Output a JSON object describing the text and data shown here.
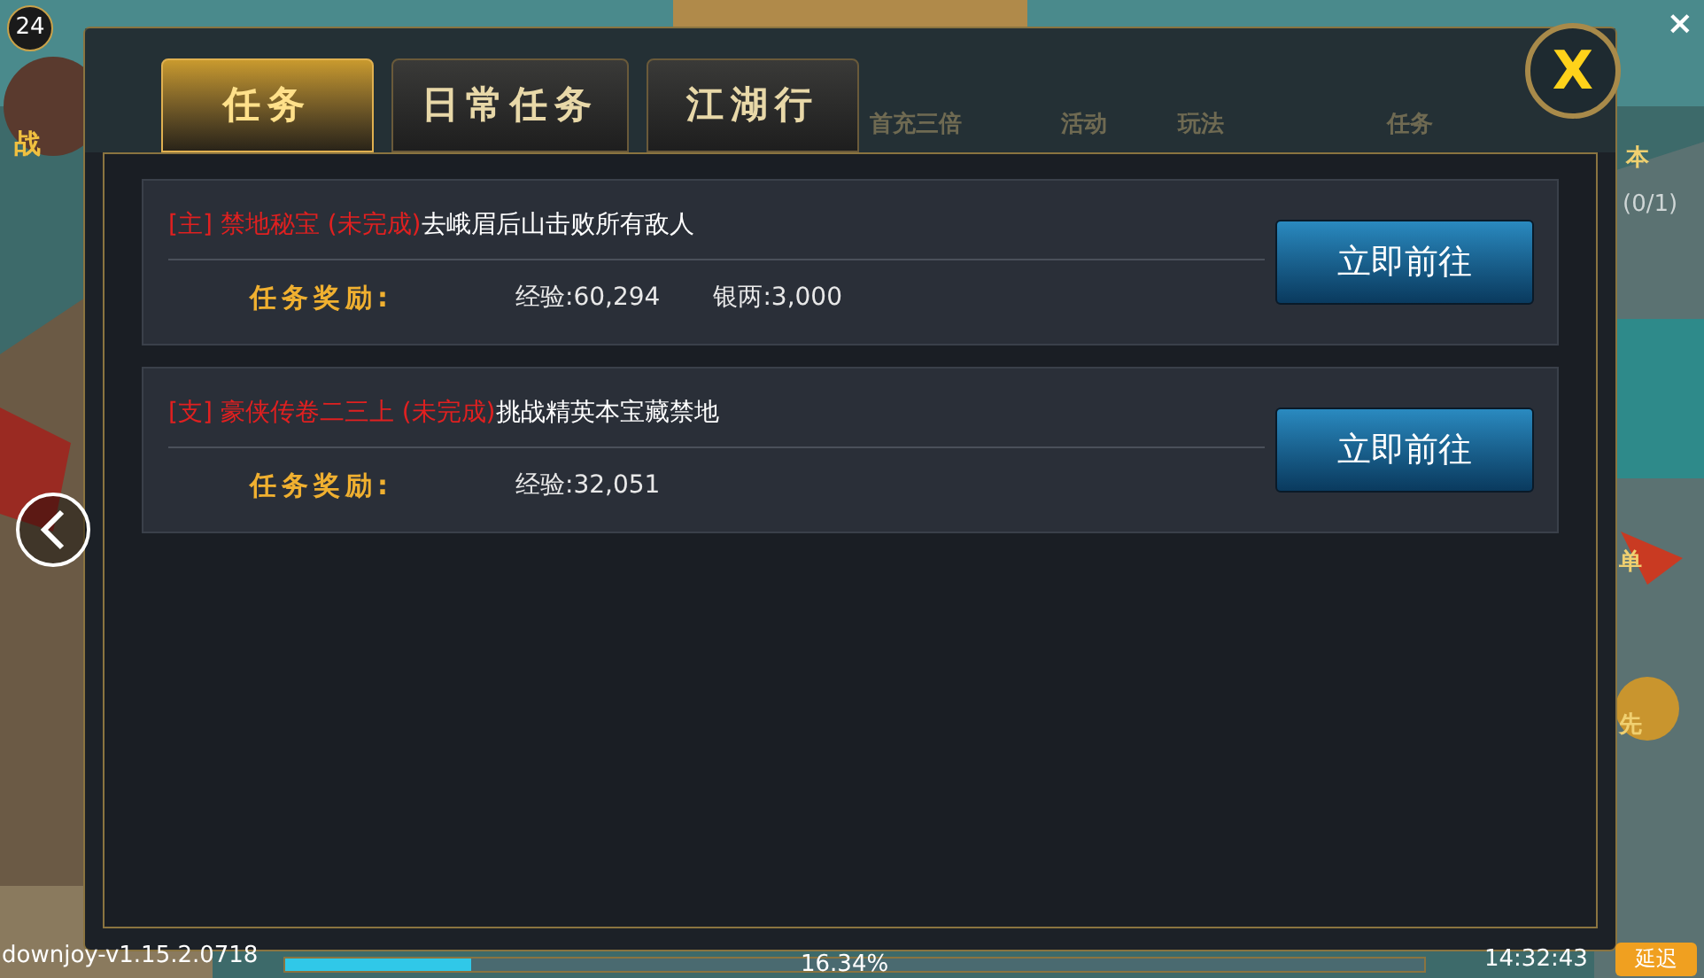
{
  "hud": {
    "level": "24",
    "power_label": "战",
    "corner_close": "×",
    "menu_labels": [
      "首充三倍",
      "活动",
      "玩法",
      "任务"
    ],
    "side_labels": [
      "本",
      "(0/1)",
      "单",
      "先"
    ]
  },
  "dialog": {
    "tabs": [
      {
        "label": "任务",
        "selected": true
      },
      {
        "label": "日常任务",
        "selected": false
      },
      {
        "label": "江湖行",
        "selected": false
      }
    ],
    "close_label": "X",
    "quests": [
      {
        "tag": "[主]",
        "name": "禁地秘宝",
        "status": "(未完成)",
        "goal": "去峨眉后山击败所有敌人",
        "reward_label": "任务奖励:",
        "rewards": [
          "经验:60,294",
          "银两:3,000"
        ],
        "button": "立即前往"
      },
      {
        "tag": "[支]",
        "name": "豪侠传卷二三上",
        "status": "(未完成)",
        "goal": "挑战精英本宝藏禁地",
        "reward_label": "任务奖励:",
        "rewards": [
          "经验:32,051"
        ],
        "button": "立即前往"
      }
    ]
  },
  "status_bar": {
    "version": "downjoy-v1.15.2.0718",
    "progress": {
      "level": 0.1634,
      "reading": "16.34%"
    },
    "time": "14:32:43",
    "latency_button": "延迟"
  }
}
